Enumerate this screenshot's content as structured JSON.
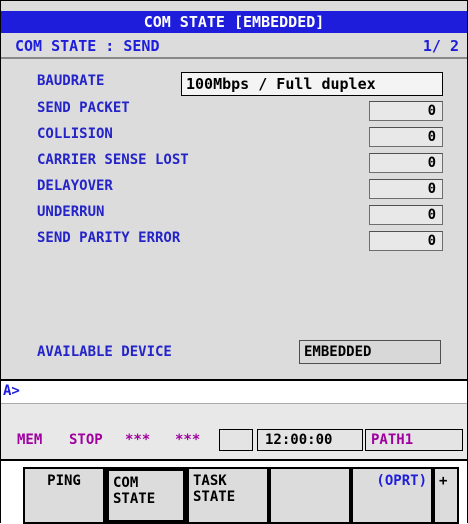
{
  "header": {
    "title": "COM STATE [EMBEDDED]"
  },
  "subheader": {
    "left": "COM STATE : SEND",
    "page": "1/ 2"
  },
  "baudrate": {
    "label": "BAUDRATE",
    "value": "100Mbps / Full duplex"
  },
  "counters": [
    {
      "label": "SEND PACKET",
      "value": "0"
    },
    {
      "label": "COLLISION",
      "value": "0"
    },
    {
      "label": "CARRIER SENSE LOST",
      "value": "0"
    },
    {
      "label": "DELAYOVER",
      "value": "0"
    },
    {
      "label": "UNDERRUN",
      "value": "0"
    },
    {
      "label": "SEND PARITY ERROR",
      "value": "0"
    }
  ],
  "available": {
    "label": "AVAILABLE DEVICE",
    "value": "EMBEDDED"
  },
  "cmdline": {
    "prompt": "A>"
  },
  "status": {
    "mode": "MEM",
    "state": "STOP",
    "flags1": "***",
    "flags2": "***",
    "time": "12:00:00",
    "path": "PATH1"
  },
  "softkeys": [
    {
      "line1": "PING",
      "line2": ""
    },
    {
      "line1": "COM",
      "line2": "STATE"
    },
    {
      "line1": "TASK",
      "line2": "STATE"
    },
    {
      "line1": "",
      "line2": ""
    },
    {
      "line1": "(OPRT)",
      "line2": ""
    },
    {
      "line1": "+",
      "line2": ""
    }
  ],
  "colors": {
    "title_bg": "#1d1ddb",
    "label": "#2424c8",
    "status_purple": "#a000a0"
  }
}
